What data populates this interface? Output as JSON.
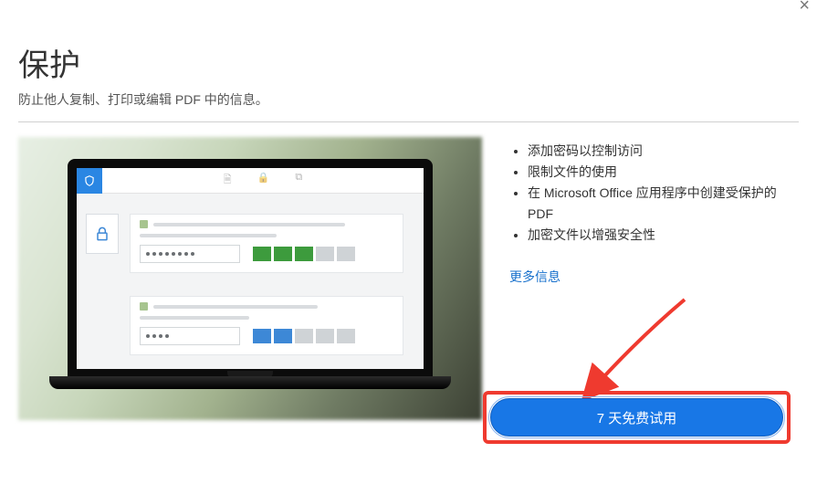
{
  "header": {
    "title": "保护",
    "subtitle": "防止他人复制、打印或编辑 PDF 中的信息。"
  },
  "features": {
    "items": [
      "添加密码以控制访问",
      "限制文件的使用",
      "在 Microsoft Office 应用程序中创建受保护的 PDF",
      "加密文件以增强安全性"
    ]
  },
  "links": {
    "more_info": "更多信息"
  },
  "cta": {
    "trial_label": "7 天免费试用"
  },
  "illustration": {
    "password_masked_long": "* * * * * * * *",
    "password_masked_short": "* * * *",
    "strength1": [
      "green",
      "green",
      "green",
      "grey",
      "grey"
    ],
    "strength2": [
      "blue",
      "blue",
      "grey",
      "grey",
      "grey"
    ]
  },
  "icons": {
    "close": "close-icon",
    "shield": "shield-icon",
    "lock": "lock-icon",
    "arrow": "red-arrow-annotation"
  },
  "colors": {
    "accent_blue": "#1877e6",
    "link_blue": "#1770cc",
    "highlight_red": "#ef3a2f",
    "strength_green": "#3d9b3d",
    "strength_blue": "#3d88d6"
  }
}
